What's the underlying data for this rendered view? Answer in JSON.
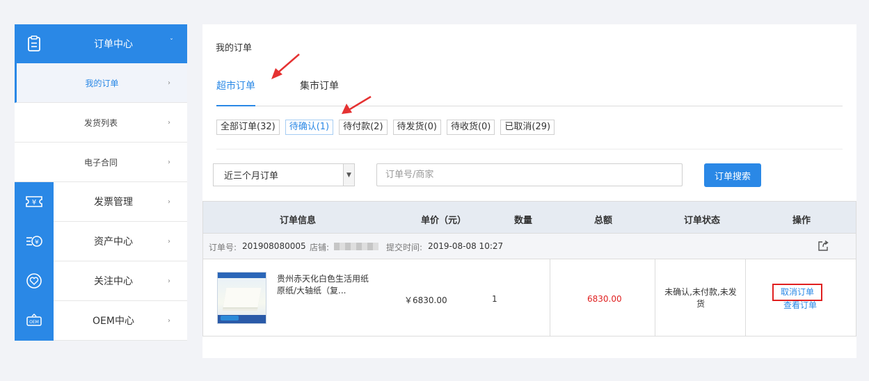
{
  "sidebar": {
    "order_center": {
      "label": "订单中心"
    },
    "sub_items": [
      {
        "label": "我的订单"
      },
      {
        "label": "发货列表"
      },
      {
        "label": "电子合同"
      }
    ],
    "main_items": [
      {
        "label": "发票管理"
      },
      {
        "label": "资产中心"
      },
      {
        "label": "关注中心"
      },
      {
        "label": "OEM中心"
      }
    ]
  },
  "main": {
    "title": "我的订单",
    "tabs": [
      {
        "label": "超市订单",
        "active": true
      },
      {
        "label": "集市订单",
        "active": false
      }
    ],
    "filters": [
      {
        "label": "全部订单(32)"
      },
      {
        "label": "待确认(1)"
      },
      {
        "label": "待付款(2)"
      },
      {
        "label": "待发货(0)"
      },
      {
        "label": "待收货(0)"
      },
      {
        "label": "已取消(29)"
      }
    ],
    "period_select": {
      "value": "近三个月订单"
    },
    "search": {
      "placeholder": "订单号/商家"
    },
    "search_button": "订单搜索",
    "table": {
      "headers": [
        "订单信息",
        "单价（元）",
        "数量",
        "总额",
        "订单状态",
        "操作"
      ],
      "order": {
        "order_no_label": "订单号:",
        "order_no": "201908080005",
        "shop_label": "店铺:",
        "time_label": "提交时间:",
        "time": "2019-08-08 10:27",
        "product_name": "贵州赤天化白色生活用纸原纸/大轴纸（复...",
        "unit_price": "￥6830.00",
        "quantity": "1",
        "total": "6830.00",
        "status": "未确认,未付款,未发货",
        "actions": {
          "cancel": "取消订单",
          "view": "查看订单"
        }
      }
    }
  },
  "colors": {
    "accent": "#2a88e6",
    "danger": "#e02020"
  }
}
